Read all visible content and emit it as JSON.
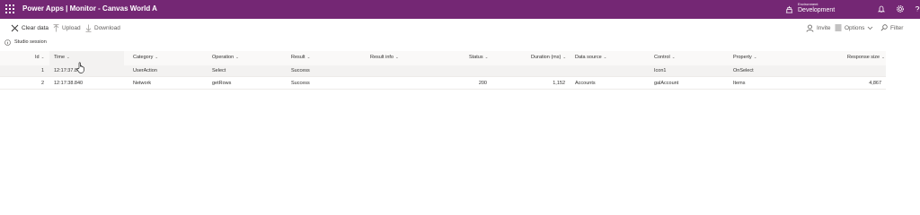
{
  "topbar": {
    "app_title": "Power Apps  |  Monitor - Canvas World A",
    "environment_label": "Environment",
    "environment_name": "Development",
    "bg_color": "#742774"
  },
  "toolbar": {
    "clear_label": "Clear data",
    "upload_label": "Upload",
    "download_label": "Download",
    "invite_label": "Invite",
    "options_label": "Options",
    "filter_label": "Filter"
  },
  "session": {
    "label": "Studio session"
  },
  "table": {
    "columns": {
      "id": "Id",
      "time": "Time",
      "category": "Category",
      "operation": "Operation",
      "result": "Result",
      "result_info": "Result info",
      "status": "Status",
      "duration": "Duration (ms)",
      "data_source": "Data source",
      "control": "Control",
      "property": "Property",
      "response_size": "Response size"
    },
    "rows": [
      {
        "id": "1",
        "time": "12:17:37.8",
        "category": "UserAction",
        "operation": "Select",
        "result": "Success",
        "result_info": "",
        "status": "",
        "duration": "",
        "data_source": "",
        "control": "Icon1",
        "property": "OnSelect",
        "response_size": ""
      },
      {
        "id": "2",
        "time": "12:17:38.840",
        "category": "Network",
        "operation": "getRows",
        "result": "Success",
        "result_info": "",
        "status": "200",
        "duration": "1,152",
        "data_source": "Accounts",
        "control": "galAccount",
        "property": "Items",
        "response_size": "4,867"
      }
    ]
  }
}
